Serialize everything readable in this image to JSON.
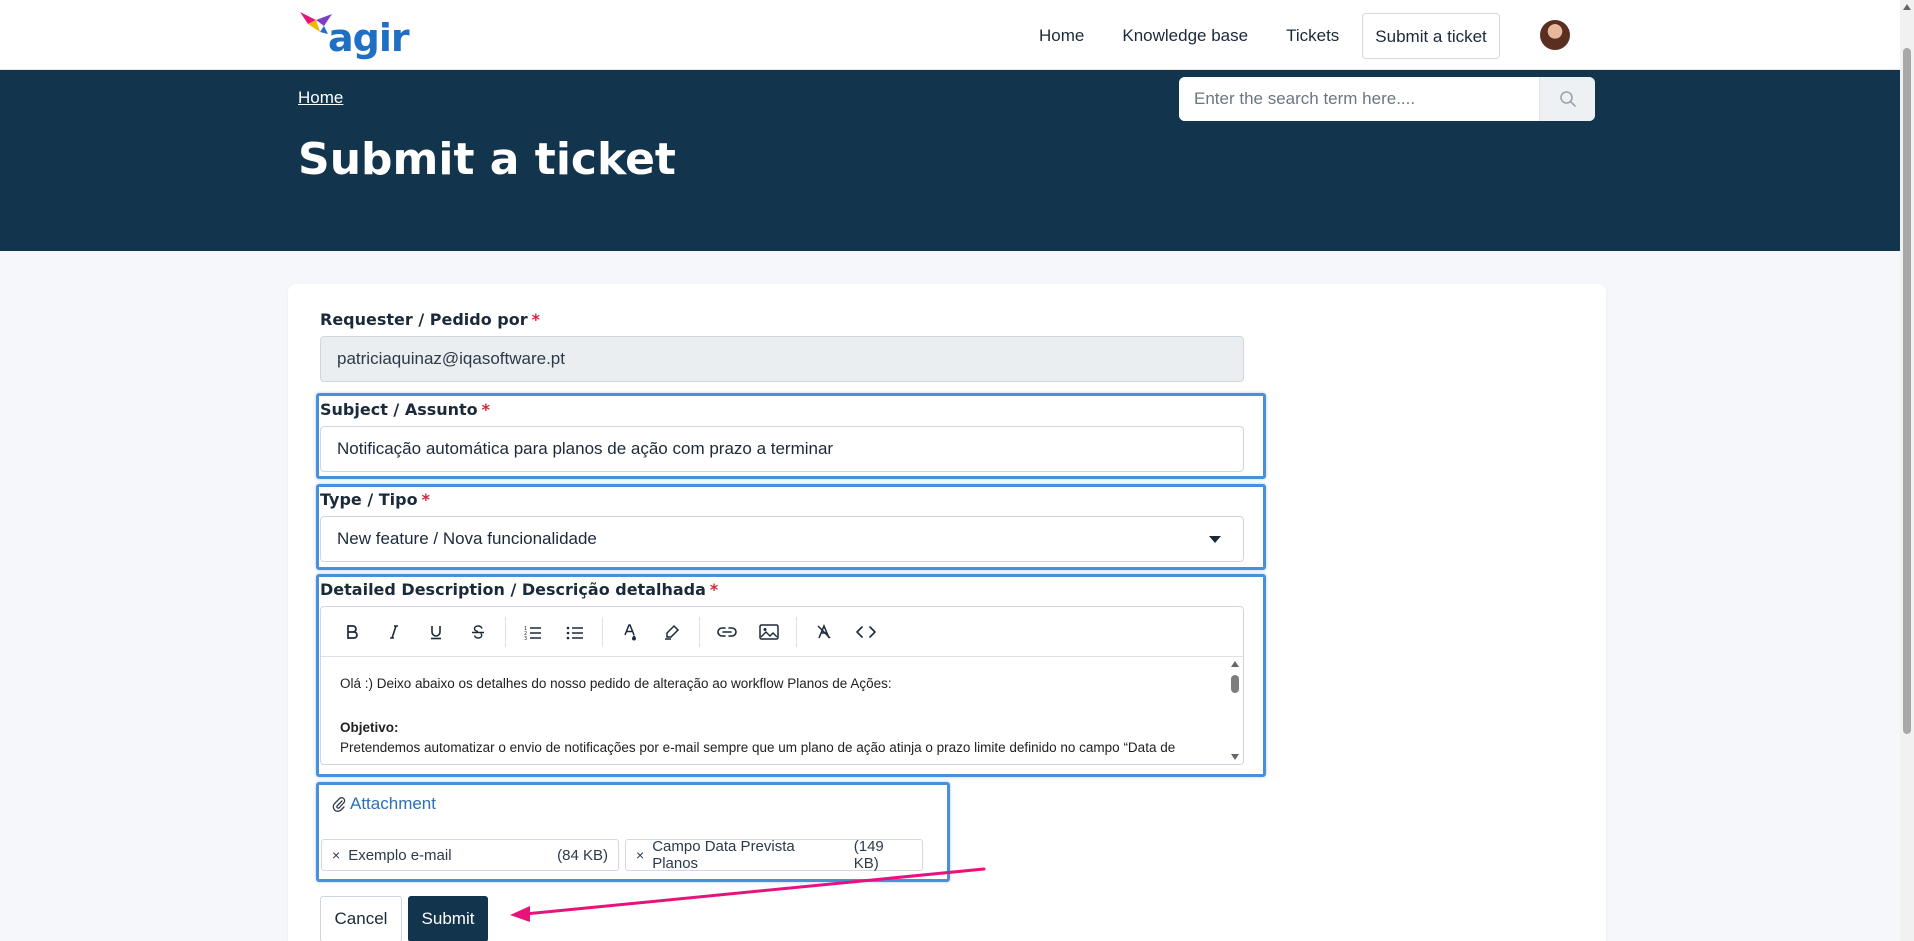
{
  "brand": {
    "name": "agir"
  },
  "nav": {
    "items": [
      {
        "label": "Home"
      },
      {
        "label": "Knowledge base"
      },
      {
        "label": "Tickets"
      },
      {
        "label": "Submit a ticket"
      }
    ]
  },
  "hero": {
    "breadcrumb": "Home",
    "title": "Submit a ticket",
    "search_placeholder": "Enter the search term here...."
  },
  "form": {
    "requester": {
      "label": "Requester / Pedido por",
      "value": "patriciaquinaz@iqasoftware.pt"
    },
    "subject": {
      "label": "Subject / Assunto",
      "value": "Notificação automática para planos de ação com prazo a terminar"
    },
    "type": {
      "label": "Type / Tipo",
      "value": "New feature / Nova funcionalidade"
    },
    "description": {
      "label": "Detailed Description / Descrição detalhada",
      "line1": "Olá :) Deixo abaixo os detalhes do nosso pedido de alteração ao workflow Planos de Ações:",
      "heading": "Objetivo:",
      "line2": "Pretendemos automatizar o envio de notificações por e-mail sempre que um plano de ação atinja o prazo limite definido no campo “Data de"
    },
    "required_mark": "*",
    "attachment_label": "Attachment",
    "attachments": [
      {
        "name": "Exemplo e-mail",
        "size": "(84 KB)"
      },
      {
        "name": "Campo Data Prevista Planos",
        "size": "(149 KB)"
      }
    ],
    "remove_symbol": "×",
    "cancel_label": "Cancel",
    "submit_label": "Submit"
  },
  "colors": {
    "hero": "#12344d",
    "highlight": "#4a90d9",
    "annotation_arrow": "#e8137a",
    "required": "#d0263b",
    "link": "#2b6fb8"
  }
}
